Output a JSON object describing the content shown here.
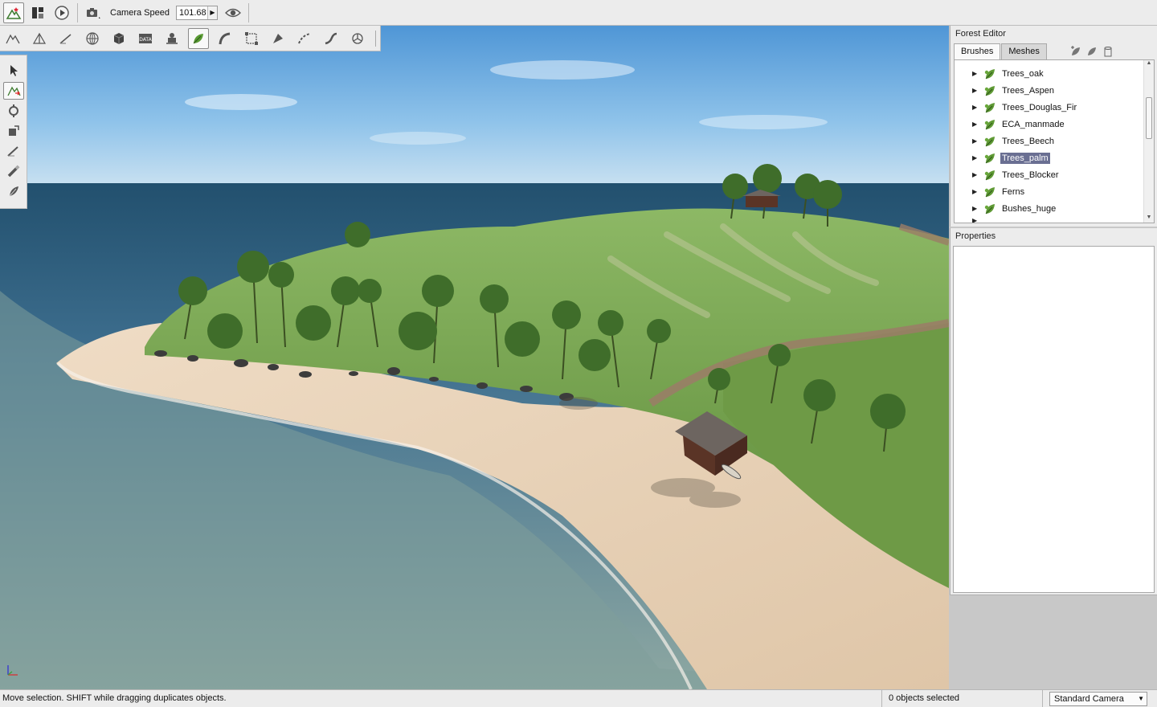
{
  "toolbar": {
    "camera_speed_label": "Camera Speed",
    "camera_speed_value": "101.68"
  },
  "editor_tools": [
    "terrain-icon",
    "mesh-icon",
    "paint-icon",
    "globe-icon",
    "cube-icon",
    "data-icon",
    "robot-icon",
    "forest-icon",
    "road-icon",
    "frame-icon",
    "river-icon",
    "decal-icon",
    "path-icon",
    "nav-icon"
  ],
  "palette_tools": [
    "select-arrow-icon",
    "move-icon",
    "rotate-icon",
    "scale-icon",
    "paint-brush-icon",
    "erase-icon",
    "forest-brush-icon"
  ],
  "forest_editor": {
    "title": "Forest Editor",
    "tabs": [
      "Brushes",
      "Meshes"
    ],
    "active_tab": 0,
    "items": [
      {
        "label": "Trees_oak",
        "selected": false
      },
      {
        "label": "Trees_Aspen",
        "selected": false
      },
      {
        "label": "Trees_Douglas_Fir",
        "selected": false
      },
      {
        "label": "ECA_manmade",
        "selected": false
      },
      {
        "label": "Trees_Beech",
        "selected": false
      },
      {
        "label": "Trees_palm",
        "selected": true
      },
      {
        "label": "Trees_Blocker",
        "selected": false
      },
      {
        "label": "Ferns",
        "selected": false
      },
      {
        "label": "Bushes_huge",
        "selected": false
      }
    ]
  },
  "properties": {
    "title": "Properties"
  },
  "statusbar": {
    "message": "Move selection.  SHIFT while dragging duplicates objects.",
    "selection": "0 objects selected",
    "camera_mode": "Standard Camera"
  },
  "colors": {
    "sea": "#5d8aa3",
    "sand": "#e7d2b8",
    "grass": "#7fa653",
    "selection": "#6a6f92"
  }
}
